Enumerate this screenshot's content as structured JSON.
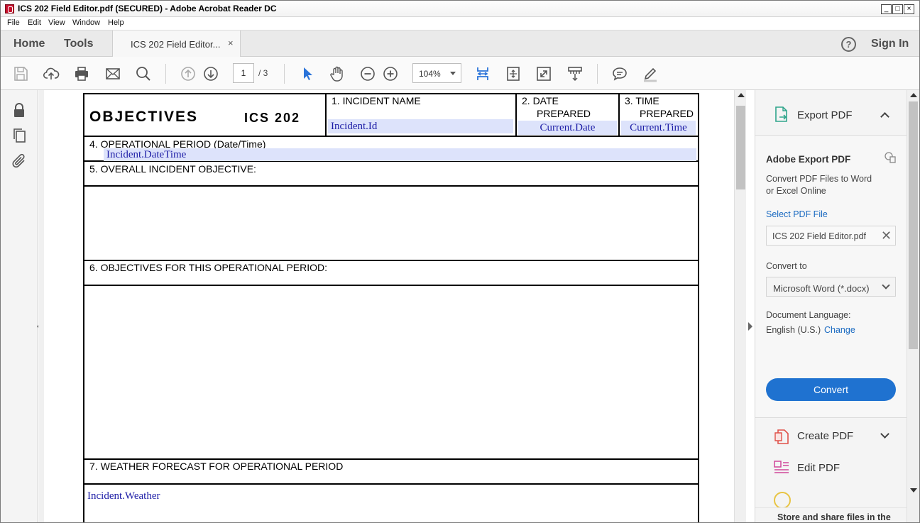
{
  "window": {
    "title": "ICS 202 Field Editor.pdf (SECURED) - Adobe Acrobat Reader DC"
  },
  "menu": {
    "items": [
      "File",
      "Edit",
      "View",
      "Window",
      "Help"
    ]
  },
  "tabs": {
    "home": "Home",
    "tools": "Tools",
    "doc": "ICS 202 Field Editor...",
    "close": "×",
    "help": "?",
    "signin": "Sign In"
  },
  "toolbar": {
    "page_current": "1",
    "page_total": "/ 3",
    "zoom": "104%"
  },
  "form": {
    "title": "OBJECTIVES",
    "form_id": "ICS 202",
    "incident_name_label": "1.  INCIDENT NAME",
    "incident_name_value": "Incident.Id",
    "date_label_1": "2.  DATE",
    "date_label_2": "PREPARED",
    "date_value": "Current.Date",
    "time_label_1": "3.  TIME",
    "time_label_2": "PREPARED",
    "time_value": "Current.Time",
    "op_period_label": "4.  OPERATIONAL PERIOD (Date/Time)",
    "op_period_value": "Incident.DateTime",
    "overall_label": "5.  OVERALL INCIDENT OBJECTIVE:",
    "objectives_label": "6.  OBJECTIVES FOR THIS OPERATIONAL PERIOD:",
    "weather_label": "7.  WEATHER FORECAST FOR OPERATIONAL PERIOD",
    "weather_value": "Incident.Weather"
  },
  "right_pane": {
    "export_header": "Export PDF",
    "title": "Adobe Export PDF",
    "desc_1": "Convert PDF Files to Word",
    "desc_2": "or Excel Online",
    "select_label": "Select PDF File",
    "file_name": "ICS 202 Field Editor.pdf",
    "convert_to_label": "Convert to",
    "convert_to_value": "Microsoft Word (*.docx)",
    "doc_lang_label": "Document Language:",
    "doc_lang_value": "English (U.S.)",
    "change_link": "Change",
    "convert_button": "Convert",
    "create_pdf": "Create PDF",
    "edit_pdf": "Edit PDF",
    "store_share": "Store and share files in the"
  },
  "colors": {
    "accent": "#1f72d0",
    "field_bg": "#dde3fb",
    "field_text": "#1c1ca6",
    "tool_blue": "#2a73d9"
  }
}
